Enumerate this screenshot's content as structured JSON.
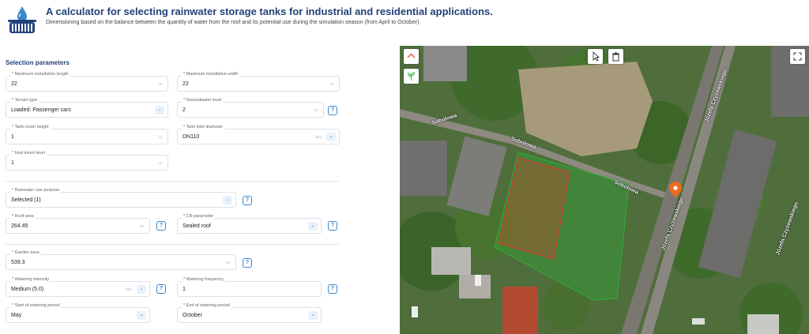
{
  "header": {
    "title": "A calculator for selecting rainwater storage tanks for industrial and residential applications.",
    "subtitle": "Dimensioning based on the balance between the quantity of water from the roof and its potential use during the simulation season (from April to October)."
  },
  "form": {
    "section_title": "Selection parameters",
    "max_length": {
      "label": "* Maximum installation length",
      "value": "22",
      "unit": "m"
    },
    "max_width": {
      "label": "* Maximum installation width",
      "value": "22",
      "unit": "m"
    },
    "terrain_type": {
      "label": "* Terrain type",
      "value": "Loaded: Passenger cars"
    },
    "groundwater": {
      "label": "* Groundwater level",
      "value": "2",
      "unit": "m"
    },
    "cover_height": {
      "label": "* Tank cover height",
      "value": "1",
      "unit": "m"
    },
    "inlet_diameter": {
      "label": "* Tank inlet diameter",
      "value": "DN110",
      "unit": "mm"
    },
    "invert_level": {
      "label": "* Inlet invert level",
      "value": "1",
      "unit": "m"
    },
    "use_purpose": {
      "label": "* Rainwater use purpose",
      "value": "Selected (1)"
    },
    "roof_area": {
      "label": "* Roof area",
      "value": "264.45",
      "unit": "m²"
    },
    "cn_param": {
      "label": "* CN parameter",
      "value": "Sealed roof"
    },
    "garden_area": {
      "label": "* Garden area",
      "value": "539.3",
      "unit": "m²"
    },
    "watering_intensity": {
      "label": "* Watering intensity",
      "value": "Medium (5.0)",
      "unit": "l/m²"
    },
    "watering_frequency": {
      "label": "* Watering frequency",
      "value": "1"
    },
    "watering_start": {
      "label": "* Start of watering period",
      "value": "May"
    },
    "watering_end": {
      "label": "* End of watering period",
      "value": "October"
    },
    "help_glyph": "?",
    "dropdown_glyph": "⌄"
  },
  "map": {
    "streets": [
      "Sobolowa",
      "Sobolowa",
      "Sobolowa",
      "Józefa Czyżewskiego",
      "Józefa Czyżewskiego",
      "Józefa Czyżewskiego"
    ],
    "colors": {
      "polygon_green": "#2fae3a",
      "polygon_red": "#d33b2c",
      "marker": "#ee6a1f"
    },
    "icons": [
      "home-icon",
      "plant-icon",
      "cursor-icon",
      "trash-icon",
      "fullscreen-icon"
    ]
  },
  "colors": {
    "title": "#24427a",
    "accent": "#3a86cf"
  }
}
